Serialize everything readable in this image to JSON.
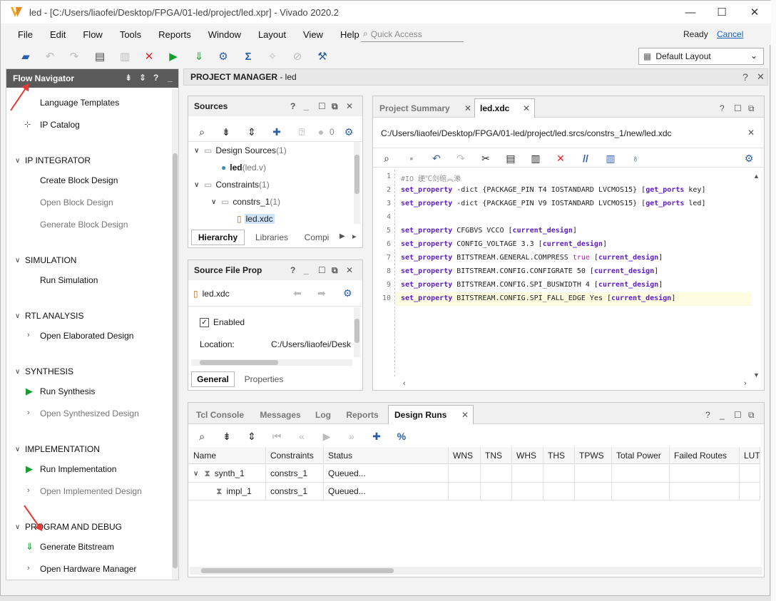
{
  "window": {
    "title": "led - [C:/Users/liaofei/Desktop/FPGA/01-led/project/led.xpr] - Vivado 2020.2",
    "minimize": "—",
    "maximize": "☐",
    "close": "✕"
  },
  "menu": {
    "items": [
      "File",
      "Edit",
      "Flow",
      "Tools",
      "Reports",
      "Window",
      "Layout",
      "View",
      "Help"
    ],
    "quick_access_placeholder": "Quick Access",
    "status": "Ready",
    "cancel": "Cancel"
  },
  "toolbar": {
    "layout_select": "Default Layout"
  },
  "flow_navigator": {
    "title": "Flow Navigator",
    "top_items": [
      "Language Templates",
      "IP Catalog"
    ],
    "sections": [
      {
        "name": "IP INTEGRATOR",
        "items": [
          "Create Block Design",
          "Open Block Design",
          "Generate Block Design"
        ]
      },
      {
        "name": "SIMULATION",
        "items": [
          "Run Simulation"
        ]
      },
      {
        "name": "RTL ANALYSIS",
        "items": [
          "Open Elaborated Design"
        ]
      },
      {
        "name": "SYNTHESIS",
        "items": [
          "Run Synthesis",
          "Open Synthesized Design"
        ]
      },
      {
        "name": "IMPLEMENTATION",
        "items": [
          "Run Implementation",
          "Open Implemented Design"
        ]
      },
      {
        "name": "PROGRAM AND DEBUG",
        "items": [
          "Generate Bitstream",
          "Open Hardware Manager"
        ]
      }
    ]
  },
  "project_manager": {
    "title": "PROJECT MANAGER",
    "project": " - led"
  },
  "sources": {
    "title": "Sources",
    "count_badge": "0",
    "tree": {
      "design_sources": "Design Sources",
      "design_sources_count": " (1)",
      "led": "led",
      "led_file": " (led.v)",
      "constraints": "Constraints",
      "constraints_count": " (1)",
      "constrs": "constrs_1",
      "constrs_count": " (1)",
      "xdc": "led.xdc"
    },
    "tabs": [
      "Hierarchy",
      "Libraries",
      "Compi"
    ]
  },
  "source_props": {
    "title": "Source File Prop",
    "file": "led.xdc",
    "enabled_label": "Enabled",
    "location_label": "Location:",
    "location_value": "C:/Users/liaofei/Desk",
    "tabs": [
      "General",
      "Properties"
    ]
  },
  "editor": {
    "tabs": [
      "Project Summary",
      "led.xdc"
    ],
    "path": "C:/Users/liaofei/Desktop/FPGA/01-led/project/led.srcs/constrs_1/new/led.xdc",
    "line_numbers": [
      "1",
      "2",
      "3",
      "4",
      "5",
      "6",
      "7",
      "8",
      "9",
      "10"
    ],
    "code": {
      "l1": "#IO 绠℃剑绾︽潫",
      "l2a": "set_property",
      "l2b": " -dict {PACKAGE_PIN T4 IOSTANDARD LVCMOS15} [",
      "l2c": "get_ports",
      "l2d": " key]",
      "l3a": "set_property",
      "l3b": " -dict {PACKAGE_PIN V9 IOSTANDARD LVCMOS15} [",
      "l3c": "get_ports",
      "l3d": " led]",
      "l5a": "set_property",
      "l5b": " CFGBVS VCCO [",
      "l5c": "current_design",
      "l5d": "]",
      "l6a": "set_property",
      "l6b": " CONFIG_VOLTAGE 3.3 [",
      "l6c": "current_design",
      "l6d": "]",
      "l7a": "set_property",
      "l7b": " BITSTREAM.GENERAL.COMPRESS ",
      "l7t": "true",
      "l7e": " [",
      "l7c": "current_design",
      "l7d": "]",
      "l8a": "set_property",
      "l8b": " BITSTREAM.CONFIG.CONFIGRATE 50 [",
      "l8c": "current_design",
      "l8d": "]",
      "l9a": "set_property",
      "l9b": " BITSTREAM.CONFIG.SPI_BUSWIDTH 4 [",
      "l9c": "current_design",
      "l9d": "]",
      "l10a": "set_property",
      "l10b": " BITSTREAM.CONFIG.SPI_FALL_EDGE Yes [",
      "l10c": "current_design",
      "l10d": "]"
    }
  },
  "bottom": {
    "tabs": [
      "Tcl Console",
      "Messages",
      "Log",
      "Reports",
      "Design Runs"
    ],
    "columns": [
      "Name",
      "Constraints",
      "Status",
      "WNS",
      "TNS",
      "WHS",
      "THS",
      "TPWS",
      "Total Power",
      "Failed Routes",
      "LUT"
    ],
    "rows": [
      {
        "name": "synth_1",
        "constraints": "constrs_1",
        "status": "Queued..."
      },
      {
        "name": "impl_1",
        "constraints": "constrs_1",
        "status": "Queued..."
      }
    ]
  },
  "colors": {
    "keyword": "#5b1dc4",
    "true": "#c417c4",
    "flow_header": "#5a5a5a",
    "run_green": "#1a9c33",
    "stop_red": "#e0242a",
    "annotation_arrow": "#e53935"
  }
}
